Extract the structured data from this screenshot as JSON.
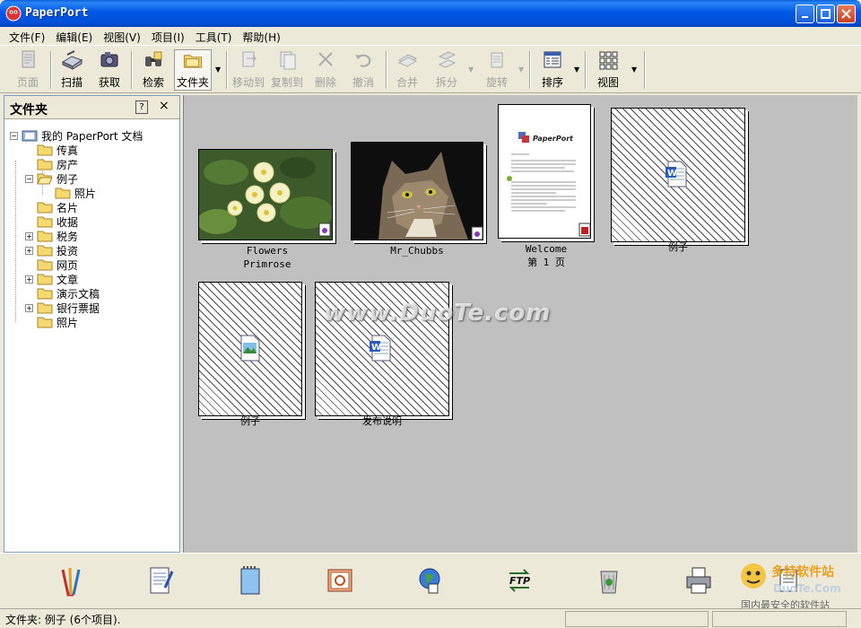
{
  "window": {
    "title": "PaperPort"
  },
  "menu": [
    "文件(F)",
    "编辑(E)",
    "视图(V)",
    "项目(I)",
    "工具(T)",
    "帮助(H)"
  ],
  "toolbar": {
    "page": "页面",
    "scan": "扫描",
    "acquire": "获取",
    "search": "检索",
    "folder": "文件夹",
    "move_to": "移动到",
    "copy_to": "复制到",
    "delete": "删除",
    "undo": "撤消",
    "merge": "合并",
    "split": "拆分",
    "rotate": "旋转",
    "sort": "排序",
    "view": "视图"
  },
  "sidebar": {
    "title": "文件夹",
    "help": "?",
    "close": "×",
    "root": "我的 PaperPort 文档",
    "folders": [
      "传真",
      "房产",
      "例子",
      "照片",
      "名片",
      "收据",
      "税务",
      "投资",
      "网页",
      "文章",
      "演示文稿",
      "银行票据",
      "照片"
    ]
  },
  "content": {
    "items": [
      {
        "caption1": "Flowers",
        "caption2": "Primrose"
      },
      {
        "caption1": "Mr_Chubbs",
        "caption2": ""
      },
      {
        "caption1": "Welcome",
        "caption2": "第 1 页"
      },
      {
        "caption1": "例子",
        "caption2": ""
      },
      {
        "caption1": "例子",
        "caption2": ""
      },
      {
        "caption1": "发布说明",
        "caption2": ""
      }
    ],
    "welcome_doc_brand": "PaperPort",
    "watermark": "www.DuoTe.com"
  },
  "sendto": [
    "word-processor",
    "notepad",
    "notes",
    "powerpoint",
    "browser",
    "ftp",
    "recycle-bin",
    "printer",
    "ocr"
  ],
  "status": {
    "text": "文件夹: 例子 (6个项目)."
  },
  "logo": {
    "line1": "多特软件站",
    "line2": "DuoTe.Com",
    "line3": "国内最安全的软件站"
  },
  "colors": {
    "titlebar": "#0058e6",
    "content_bg": "#c0c0c0",
    "chrome": "#ece9d8",
    "folder": "#f5d86e"
  }
}
